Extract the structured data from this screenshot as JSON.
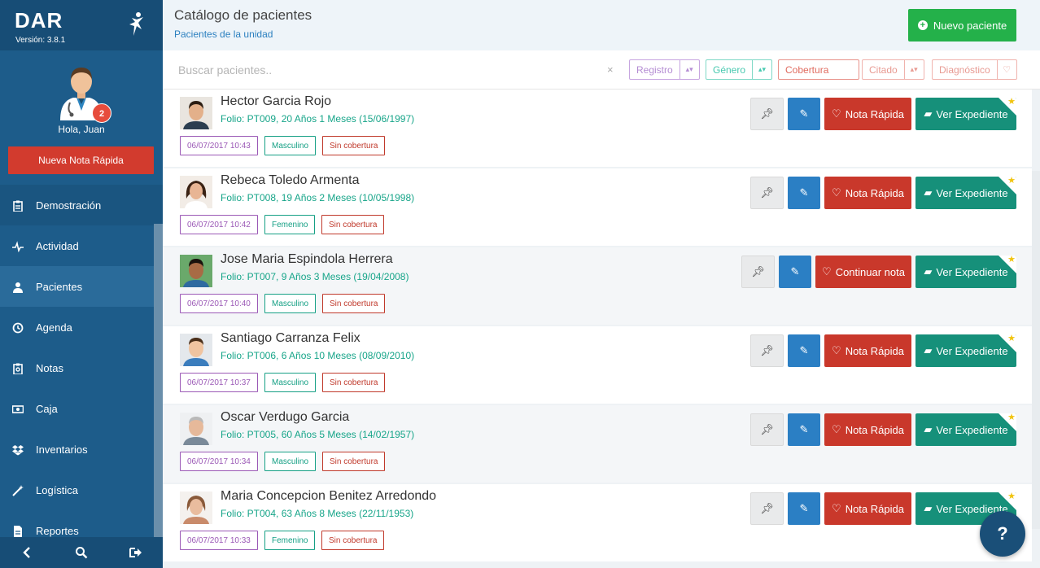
{
  "app": {
    "logo": "DAR",
    "version": "Versión: 3.8.1"
  },
  "profile": {
    "greeting": "Hola, Juan",
    "notifications": "2",
    "quick_note_label": "Nueva Nota Rápida"
  },
  "sidebar": {
    "items": [
      {
        "label": "Demostración",
        "icon": "clipboard-icon"
      },
      {
        "label": "Actividad",
        "icon": "pulse-icon"
      },
      {
        "label": "Pacientes",
        "icon": "user-icon"
      },
      {
        "label": "Agenda",
        "icon": "clock-icon"
      },
      {
        "label": "Notas",
        "icon": "note-icon"
      },
      {
        "label": "Caja",
        "icon": "money-icon"
      },
      {
        "label": "Inventarios",
        "icon": "dropbox-icon"
      },
      {
        "label": "Logística",
        "icon": "wand-icon"
      },
      {
        "label": "Reportes",
        "icon": "file-icon"
      }
    ]
  },
  "header": {
    "title": "Catálogo de pacientes",
    "subtitle": "Pacientes de la unidad",
    "new_patient_label": "Nuevo paciente"
  },
  "search": {
    "placeholder": "Buscar pacientes..",
    "clear": "×",
    "filters": {
      "registro": "Registro",
      "genero": "Género",
      "cobertura": "Cobertura",
      "citado": "Citado",
      "diagnostico": "Diagnóstico"
    }
  },
  "buttons": {
    "nota_rapida": "Nota Rápida",
    "continuar_nota": "Continuar nota",
    "ver_expediente": "Ver Expediente"
  },
  "patients": [
    {
      "name": "Hector Garcia Rojo",
      "folio": "Folio: PT009, 20 Años 1 Meses (15/06/1997)",
      "date": "06/07/2017 10:43",
      "gender": "Masculino",
      "coverage": "Sin cobertura",
      "action": "Nota Rápida"
    },
    {
      "name": "Rebeca Toledo Armenta",
      "folio": "Folio: PT008, 19 Años 2 Meses (10/05/1998)",
      "date": "06/07/2017 10:42",
      "gender": "Femenino",
      "coverage": "Sin cobertura",
      "action": "Nota Rápida"
    },
    {
      "name": "Jose Maria Espindola Herrera",
      "folio": "Folio: PT007, 9 Años 3 Meses (19/04/2008)",
      "date": "06/07/2017 10:40",
      "gender": "Masculino",
      "coverage": "Sin cobertura",
      "action": "Continuar nota"
    },
    {
      "name": "Santiago Carranza Felix",
      "folio": "Folio: PT006, 6 Años 10 Meses (08/09/2010)",
      "date": "06/07/2017 10:37",
      "gender": "Masculino",
      "coverage": "Sin cobertura",
      "action": "Nota Rápida"
    },
    {
      "name": "Oscar Verdugo Garcia",
      "folio": "Folio: PT005, 60 Años 5 Meses (14/02/1957)",
      "date": "06/07/2017 10:34",
      "gender": "Masculino",
      "coverage": "Sin cobertura",
      "action": "Nota Rápida"
    },
    {
      "name": "Maria Concepcion Benitez Arredondo",
      "folio": "Folio: PT004, 63 Años 8 Meses (22/11/1953)",
      "date": "06/07/2017 10:33",
      "gender": "Femenino",
      "coverage": "Sin cobertura",
      "action": "Nota Rápida"
    }
  ],
  "help": "?",
  "colors": {
    "sidebar": "#1d5c8a",
    "primary_green": "#24b14a",
    "red": "#c9382b",
    "blue": "#2b7fc4",
    "teal": "#16907a"
  }
}
